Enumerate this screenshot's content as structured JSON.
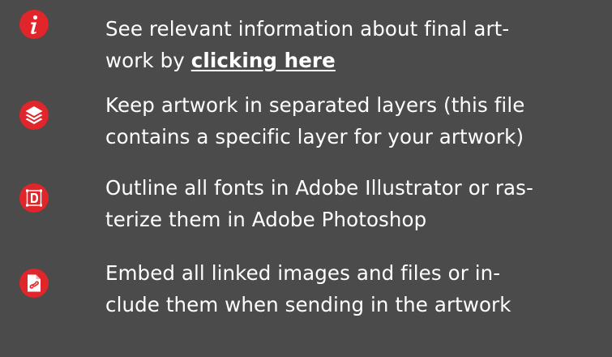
{
  "colors": {
    "background": "#4b4b4b",
    "accent": "#e0262b",
    "text": "#ffffff"
  },
  "items": [
    {
      "icon": "info-icon",
      "line1": "See relevant information about final art-",
      "line2_prefix": "work by ",
      "link_label": "clicking here"
    },
    {
      "icon": "layers-icon",
      "line1": "Keep artwork in separated layers (this file",
      "line2": "contains a specific layer for your artwork)"
    },
    {
      "icon": "outline-text-icon",
      "line1": "Outline all fonts in Adobe Illustrator or ras-",
      "line2": "terize them in Adobe Photoshop"
    },
    {
      "icon": "embed-file-icon",
      "line1": "Embed all linked images and files or in-",
      "line2": "clude them when sending in the artwork"
    }
  ]
}
